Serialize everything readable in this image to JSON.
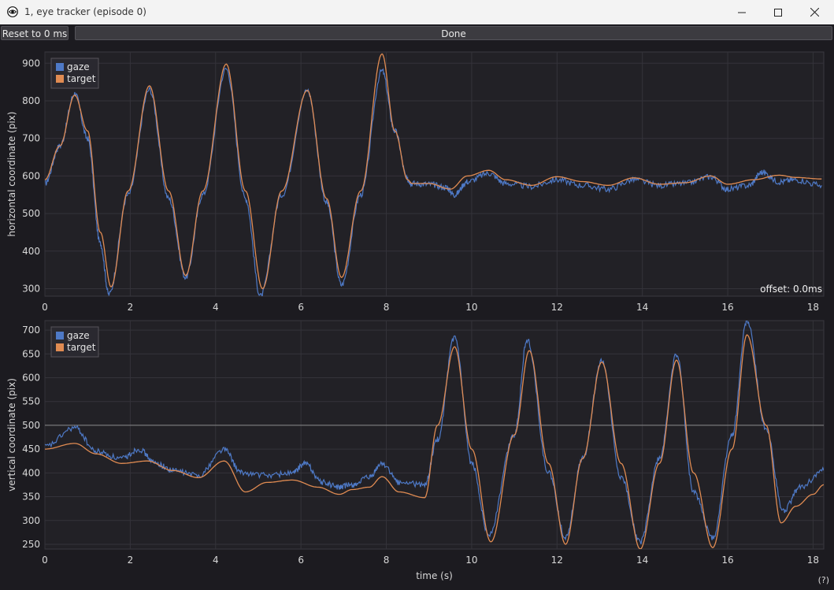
{
  "window": {
    "title": "1, eye tracker (episode 0)",
    "icon": "eye-icon",
    "controls": [
      "minimize-icon",
      "maximize-icon",
      "close-icon"
    ]
  },
  "toolbar": {
    "reset_label": "Reset to 0 ms",
    "done_label": "Done"
  },
  "help_label": "(?)",
  "colors": {
    "gaze": "#4e79c6",
    "target": "#e08b52",
    "plot_bg": "#222126",
    "grid": "#34333a",
    "axis_text": "#d8d8d8"
  },
  "chart_data": [
    {
      "type": "line",
      "title": "",
      "xlabel": "",
      "ylabel": "horizontal coordinate (pix)",
      "xlim": [
        0,
        18.25
      ],
      "ylim": [
        280,
        930
      ],
      "xticks": [
        0,
        2,
        4,
        6,
        8,
        10,
        12,
        14,
        16,
        18
      ],
      "yticks": [
        300,
        400,
        500,
        600,
        700,
        800,
        900
      ],
      "grid": true,
      "legend": "top-left",
      "annotation": "offset: 0.0ms",
      "series": [
        {
          "name": "target",
          "color": "#e08b52",
          "x": [
            0,
            0.35,
            0.7,
            1.0,
            1.3,
            1.55,
            1.95,
            2.45,
            2.9,
            3.3,
            3.7,
            4.25,
            4.7,
            5.1,
            5.55,
            6.15,
            6.6,
            6.95,
            7.4,
            7.9,
            8.2,
            8.5,
            8.6,
            9.0,
            9.5,
            9.9,
            10.4,
            10.8,
            11.4,
            12.0,
            12.6,
            13.2,
            13.8,
            14.4,
            15.0,
            15.6,
            16.0,
            16.6,
            17.2,
            17.6,
            18.2
          ],
          "y": [
            590,
            680,
            815,
            720,
            450,
            305,
            560,
            840,
            560,
            335,
            560,
            898,
            560,
            300,
            560,
            828,
            540,
            330,
            560,
            925,
            720,
            590,
            580,
            580,
            565,
            600,
            615,
            590,
            575,
            598,
            585,
            575,
            595,
            578,
            582,
            600,
            578,
            590,
            602,
            596,
            592
          ]
        },
        {
          "name": "gaze",
          "color": "#4e79c6",
          "x": [
            0,
            0.35,
            0.7,
            1.0,
            1.3,
            1.5,
            1.95,
            2.45,
            2.9,
            3.3,
            3.7,
            4.25,
            4.7,
            5.05,
            5.55,
            6.15,
            6.6,
            6.95,
            7.4,
            7.9,
            8.2,
            8.5,
            8.6,
            9.0,
            9.4,
            9.6,
            9.9,
            10.4,
            10.8,
            11.4,
            12.0,
            12.6,
            13.2,
            13.8,
            14.4,
            15.0,
            15.6,
            16.0,
            16.5,
            16.8,
            17.2,
            17.6,
            18.2
          ],
          "y": [
            580,
            680,
            820,
            700,
            420,
            285,
            550,
            830,
            540,
            330,
            550,
            885,
            540,
            280,
            550,
            828,
            530,
            310,
            550,
            880,
            720,
            590,
            580,
            578,
            570,
            550,
            585,
            607,
            580,
            572,
            590,
            575,
            565,
            590,
            575,
            580,
            598,
            565,
            575,
            610,
            585,
            590,
            575
          ]
        }
      ]
    },
    {
      "type": "line",
      "title": "",
      "xlabel": "time (s)",
      "ylabel": "vertical coordinate (pix)",
      "xlim": [
        0,
        18.25
      ],
      "ylim": [
        240,
        720
      ],
      "xticks": [
        0,
        2,
        4,
        6,
        8,
        10,
        12,
        14,
        16,
        18
      ],
      "yticks": [
        250,
        300,
        350,
        400,
        450,
        500,
        550,
        600,
        650,
        700
      ],
      "grid": true,
      "hline": 500,
      "legend": "top-left",
      "series": [
        {
          "name": "target",
          "color": "#e08b52",
          "x": [
            0,
            0.7,
            1.2,
            1.8,
            2.4,
            3.0,
            3.6,
            4.2,
            4.7,
            5.2,
            5.8,
            6.4,
            6.9,
            7.2,
            7.6,
            7.9,
            8.3,
            8.9,
            9.2,
            9.6,
            10.0,
            10.45,
            11.0,
            11.35,
            11.8,
            12.2,
            12.6,
            13.05,
            13.5,
            13.95,
            14.4,
            14.8,
            15.2,
            15.65,
            16.1,
            16.45,
            16.9,
            17.25,
            17.6,
            18.0,
            18.25
          ],
          "y": [
            450,
            462,
            440,
            420,
            425,
            405,
            390,
            425,
            360,
            380,
            385,
            370,
            355,
            365,
            370,
            392,
            360,
            348,
            500,
            665,
            450,
            255,
            480,
            657,
            420,
            250,
            430,
            633,
            420,
            240,
            420,
            637,
            400,
            243,
            450,
            690,
            500,
            295,
            330,
            355,
            375
          ]
        },
        {
          "name": "gaze",
          "color": "#4e79c6",
          "x": [
            0,
            0.7,
            1.2,
            1.8,
            2.2,
            2.6,
            3.0,
            3.6,
            4.2,
            4.6,
            5.2,
            5.8,
            6.1,
            6.5,
            6.9,
            7.2,
            7.6,
            7.9,
            8.3,
            8.9,
            9.2,
            9.6,
            10.0,
            10.4,
            11.0,
            11.3,
            11.8,
            12.2,
            12.6,
            13.05,
            13.5,
            13.95,
            14.4,
            14.8,
            15.2,
            15.65,
            16.1,
            16.45,
            16.9,
            17.3,
            17.7,
            18.25
          ],
          "y": [
            455,
            495,
            445,
            430,
            450,
            420,
            405,
            395,
            450,
            400,
            395,
            400,
            420,
            380,
            370,
            375,
            390,
            420,
            380,
            375,
            470,
            685,
            420,
            270,
            480,
            680,
            400,
            265,
            430,
            635,
            390,
            255,
            430,
            648,
            360,
            263,
            480,
            720,
            490,
            320,
            370,
            405
          ]
        }
      ]
    }
  ]
}
